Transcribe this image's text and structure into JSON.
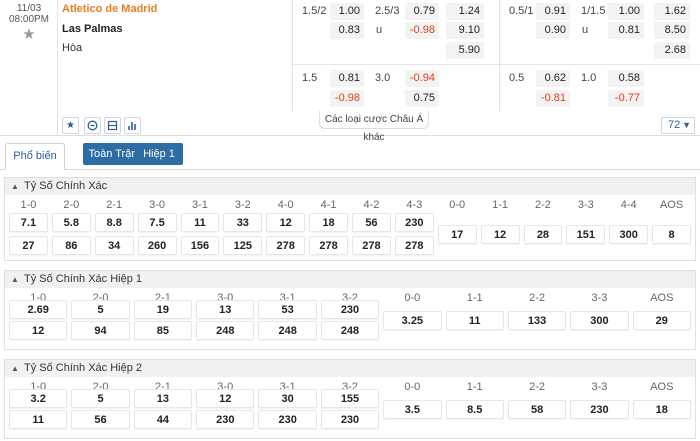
{
  "match": {
    "date": "11/03",
    "time": "08:00PM",
    "home": "Atletico de Madrid",
    "away": "Las Palmas",
    "draw": "Hòa"
  },
  "odds_ft": {
    "hdp_line": "1.5/2",
    "hdp_home": "1.00",
    "hdp_away": "0.83",
    "ou_line": "2.5/3",
    "ou_over": "0.79",
    "ou_under_label": "u",
    "ou_under": "-0.98",
    "x12_home": "1.24",
    "x12_away": "9.10",
    "x12_draw": "5.90"
  },
  "odds_ft_alt": {
    "hdp_line": "1.5",
    "hdp_home": "0.81",
    "hdp_away": "-0.98",
    "ou_line": "3.0",
    "ou_over": "-0.94",
    "ou_under": "0.75"
  },
  "odds_h1": {
    "hdp_line": "0.5/1",
    "hdp_home": "0.91",
    "hdp_away": "0.90",
    "ou_line": "1/1.5",
    "ou_over": "1.00",
    "ou_under_label": "u",
    "ou_under": "0.81",
    "x12_home": "1.62",
    "x12_away": "8.50",
    "x12_draw": "2.68"
  },
  "odds_h1_alt": {
    "hdp_line": "0.5",
    "hdp_home": "0.62",
    "hdp_away": "-0.81",
    "ou_line": "1.0",
    "ou_over": "0.58",
    "ou_under": "-0.77"
  },
  "more_bets": "Các loại cược Châu Á khác",
  "market_count": "72",
  "tabs": [
    "Phổ biến",
    "Toàn Trận",
    "Hiệp 1"
  ],
  "sections": [
    {
      "title": "Tỷ Số Chính Xác",
      "headers": [
        "1-0",
        "2-0",
        "2-1",
        "3-0",
        "3-1",
        "3-2",
        "4-0",
        "4-1",
        "4-2",
        "4-3",
        "0-0",
        "1-1",
        "2-2",
        "3-3",
        "4-4",
        "AOS"
      ],
      "home_row": [
        "7.1",
        "5.8",
        "8.8",
        "7.5",
        "11",
        "33",
        "12",
        "18",
        "56",
        "230"
      ],
      "away_row": [
        "27",
        "86",
        "34",
        "260",
        "156",
        "125",
        "278",
        "278",
        "278",
        "278"
      ],
      "draw_row": [
        "17",
        "12",
        "28",
        "151",
        "300",
        "8"
      ]
    },
    {
      "title": "Tỷ Số Chính Xác Hiệp 1",
      "headers": [
        "1-0",
        "2-0",
        "2-1",
        "3-0",
        "3-1",
        "3-2",
        "0-0",
        "1-1",
        "2-2",
        "3-3",
        "AOS"
      ],
      "home_row": [
        "2.69",
        "5",
        "19",
        "13",
        "53",
        "230"
      ],
      "away_row": [
        "12",
        "94",
        "85",
        "248",
        "248",
        "248"
      ],
      "draw_row": [
        "3.25",
        "11",
        "133",
        "300",
        "29"
      ]
    },
    {
      "title": "Tỷ Số Chính Xác Hiệp 2",
      "headers": [
        "1-0",
        "2-0",
        "2-1",
        "3-0",
        "3-1",
        "3-2",
        "0-0",
        "1-1",
        "2-2",
        "3-3",
        "AOS"
      ],
      "home_row": [
        "3.2",
        "5",
        "13",
        "12",
        "30",
        "155"
      ],
      "away_row": [
        "11",
        "56",
        "44",
        "230",
        "230",
        "230"
      ],
      "draw_row": [
        "3.5",
        "8.5",
        "58",
        "230",
        "18"
      ]
    }
  ],
  "icons": [
    "star-icon",
    "scoreboard-icon",
    "stats-list-icon",
    "bar-chart-icon",
    "chevron-down-icon",
    "chevron-up-icon"
  ],
  "colors": {
    "accent": "#2d6ca5",
    "home_team": "#e67e22",
    "negative": "#e23a1d"
  }
}
